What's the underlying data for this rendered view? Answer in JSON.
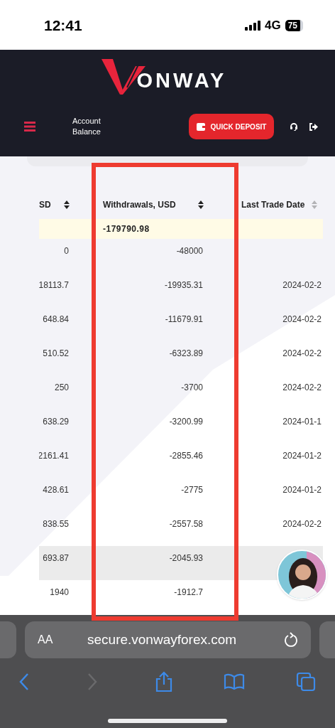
{
  "status_bar": {
    "time": "12:41",
    "network": "4G",
    "battery": "75"
  },
  "header": {
    "logo_text": "ONWAY",
    "account_label": "Account Balance",
    "deposit_button": "QUICK DEPOSIT"
  },
  "table": {
    "columns": [
      {
        "label": "SD",
        "sortable": true
      },
      {
        "label": "Withdrawals, USD",
        "sortable": true
      },
      {
        "label": "Last Trade Date",
        "sortable": true
      }
    ],
    "totals": {
      "withdrawals": "-179790.98"
    },
    "rows": [
      {
        "column_1": "0",
        "withdrawals": "-48000",
        "highlighted": false
      },
      {
        "column_1": "18113.7",
        "withdrawals": "-19935.31",
        "last_trade_date": "2024-02-2",
        "highlighted": false
      },
      {
        "column_1": "648.84",
        "withdrawals": "-11679.91",
        "last_trade_date": "2024-02-2",
        "highlighted": false
      },
      {
        "column_1": "510.52",
        "withdrawals": "-6323.89",
        "last_trade_date": "2024-02-2",
        "highlighted": false
      },
      {
        "column_1": "250",
        "withdrawals": "-3700",
        "last_trade_date": "2024-02-2",
        "highlighted": false
      },
      {
        "column_1": "638.29",
        "withdrawals": "-3200.99",
        "last_trade_date": "2024-01-1",
        "highlighted": false
      },
      {
        "column_1": "2161.41",
        "withdrawals": "-2855.46",
        "last_trade_date": "2024-01-2",
        "highlighted": false
      },
      {
        "column_1": "428.61",
        "withdrawals": "-2775",
        "last_trade_date": "2024-01-2",
        "highlighted": false
      },
      {
        "column_1": "838.55",
        "withdrawals": "-2557.58",
        "last_trade_date": "2024-02-2",
        "highlighted": false
      },
      {
        "column_1": "693.87",
        "withdrawals": "-2045.93",
        "highlighted": true
      },
      {
        "column_1": "1940",
        "withdrawals": "-1912.7",
        "highlighted": false
      }
    ]
  },
  "browser": {
    "text_size_button": "AA",
    "url": "secure.vonwayforex.com"
  }
}
